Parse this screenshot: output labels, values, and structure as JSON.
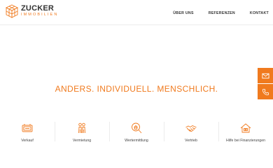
{
  "brand": {
    "name": "ZUCKER",
    "subline": "IMMOBILIEN",
    "accent": "#f07a1e"
  },
  "nav": {
    "items": [
      {
        "label": "ÜBER UNS"
      },
      {
        "label": "REFERENZEN"
      },
      {
        "label": "KONTAKT"
      }
    ]
  },
  "hero": {
    "tagline": "ANDERS. INDIVIDUELL. MENSCHLICH."
  },
  "side_buttons": {
    "mail_icon": "envelope-icon",
    "phone_icon": "phone-icon"
  },
  "services": {
    "items": [
      {
        "label": "Verkauf",
        "icon": "for-sale-sign-icon"
      },
      {
        "label": "Vermietung",
        "icon": "people-icon"
      },
      {
        "label": "Wertermittlung",
        "icon": "magnifier-house-icon"
      },
      {
        "label": "Vertrieb",
        "icon": "handshake-icon"
      },
      {
        "label": "Hilfe bei Finanzierungen",
        "icon": "house-money-icon"
      }
    ]
  }
}
